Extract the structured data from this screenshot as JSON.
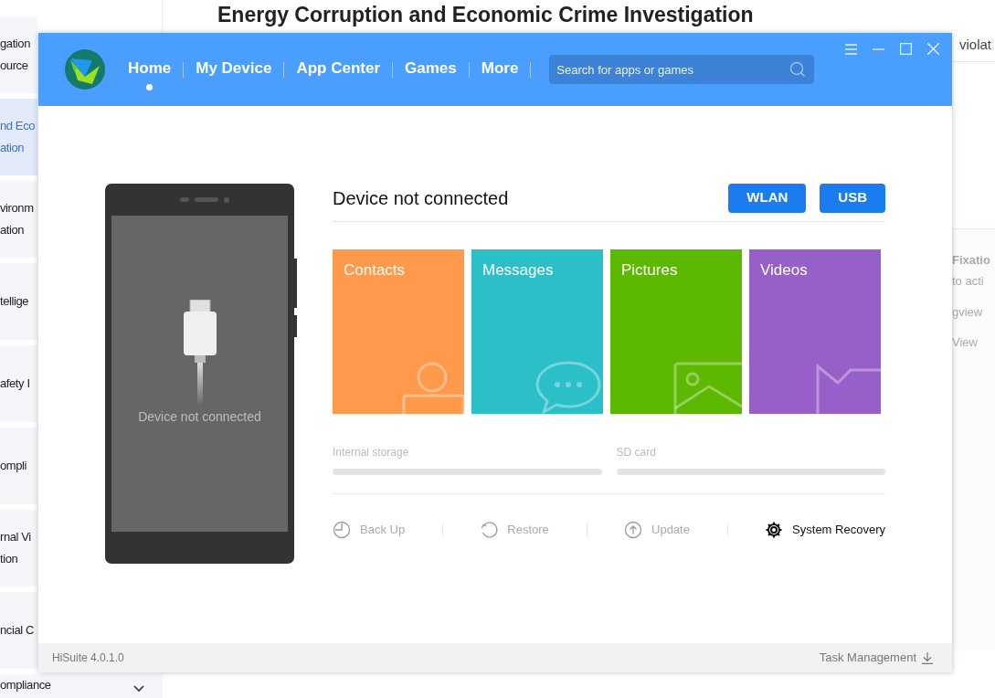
{
  "background_page": {
    "heading": "Energy Corruption and Economic Crime Investigation",
    "subline_end": "violat",
    "sidebar": [
      {
        "lines": [
          "gation",
          "ource"
        ],
        "selected": false
      },
      {
        "lines": [
          "nd Eco",
          "ation"
        ],
        "selected": true
      },
      {
        "lines": [
          "vironm",
          "ation"
        ],
        "selected": false
      },
      {
        "lines": [
          "tellige"
        ],
        "selected": false
      },
      {
        "lines": [
          "afety I"
        ],
        "selected": false
      },
      {
        "lines": [
          "ompli"
        ],
        "selected": false
      },
      {
        "lines": [
          "rnal Vi",
          "tion"
        ],
        "selected": false
      },
      {
        "lines": [
          "ncial C"
        ],
        "selected": false
      },
      {
        "lines": [
          "ompliance"
        ],
        "selected": false
      }
    ],
    "right_fragments": [
      {
        "text": "Fixatio",
        "kind": "title"
      },
      {
        "text": "to acti",
        "kind": "body"
      },
      {
        "text": "gview",
        "kind": "link"
      },
      {
        "text": "View",
        "kind": "link"
      }
    ]
  },
  "window": {
    "nav": [
      {
        "label": "Home",
        "selected": true
      },
      {
        "label": "My Device",
        "selected": false
      },
      {
        "label": "App Center",
        "selected": false
      },
      {
        "label": "Games",
        "selected": false
      },
      {
        "label": "More",
        "selected": false
      }
    ],
    "search": {
      "placeholder": "Search for apps or games"
    },
    "phone": {
      "message": "Device not connected"
    },
    "status_title": "Device not connected",
    "connect_buttons": [
      "WLAN",
      "USB"
    ],
    "tiles": [
      {
        "label": "Contacts",
        "color": "#ff9a4d",
        "kind": "contact"
      },
      {
        "label": "Messages",
        "color": "#2bbfc8",
        "kind": "message"
      },
      {
        "label": "Pictures",
        "color": "#5cb800",
        "kind": "picture"
      },
      {
        "label": "Videos",
        "color": "#975fc8",
        "kind": "video"
      }
    ],
    "storage": [
      {
        "label": "Internal storage",
        "level": 0
      },
      {
        "label": "SD card",
        "level": 0
      }
    ],
    "actions": [
      {
        "label": "Back Up",
        "kind": "backup",
        "disabled": true
      },
      {
        "label": "Restore",
        "kind": "restore",
        "disabled": true
      },
      {
        "label": "Update",
        "kind": "update",
        "disabled": true
      },
      {
        "label": "System Recovery",
        "kind": "recovery",
        "disabled": false
      }
    ],
    "version": "HiSuite 4.0.1.0",
    "task_management": "Task Management"
  }
}
